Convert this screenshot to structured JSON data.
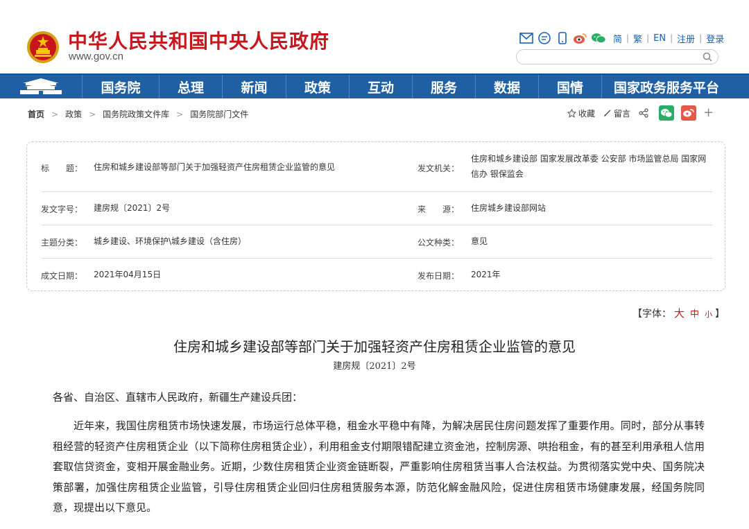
{
  "header": {
    "site_title": "中华人民共和国中央人民政府",
    "site_url": "www.gov.cn",
    "lang_links": [
      "简",
      "繁",
      "EN",
      "注册",
      "登录"
    ],
    "top_icons": [
      "mail-icon",
      "chat-icon",
      "mobile-icon",
      "weibo-icon",
      "wechat-icon"
    ]
  },
  "nav": {
    "items": [
      "国务院",
      "总理",
      "新闻",
      "政策",
      "互动",
      "服务",
      "数据",
      "国情",
      "国家政务服务平台"
    ]
  },
  "breadcrumb": [
    "首页",
    "政策",
    "国务院政策文件库",
    "国务院部门文件"
  ],
  "tools": {
    "favorite": "收藏",
    "comment": "留言"
  },
  "info": {
    "title_label": "标　　题：",
    "title_value": "住房和城乡建设部等部门关于加强轻资产住房租赁企业监管的意见",
    "issuer_label": "发文机关：",
    "issuer_value": "住房和城乡建设部 国家发展改革委 公安部 市场监管总局 国家网信办 银保监会",
    "docno_label": "发文字号：",
    "docno_value": "建房规〔2021〕2号",
    "source_label": "来　　源：",
    "source_value": "住房城乡建设部网站",
    "topic_label": "主题分类：",
    "topic_value": "城乡建设、环境保护\\城乡建设（含住房）",
    "type_label": "公文种类：",
    "type_value": "意见",
    "date_label": "成文日期：",
    "date_value": "2021年04月15日",
    "pub_label": "发布日期：",
    "pub_value": "2021年"
  },
  "fontsize": {
    "prefix": "【字体：",
    "large": "大",
    "medium": "中",
    "small": "小",
    "suffix": "】"
  },
  "article": {
    "title": "住房和城乡建设部等部门关于加强轻资产住房租赁企业监管的意见",
    "docno": "建房规〔2021〕2号",
    "greeting": "各省、自治区、直辖市人民政府，新疆生产建设兵团：",
    "body": "近年来，我国住房租赁市场快速发展，市场运行总体平稳，租金水平稳中有降，为解决居民住房问题发挥了重要作用。同时，部分从事转租经营的轻资产住房租赁企业（以下简称住房租赁企业），利用租金支付期限错配建立资金池，控制房源、哄抬租金，有的甚至利用承租人信用套取信贷资金，变相开展金融业务。近期，少数住房租赁企业资金链断裂，严重影响住房租赁当事人合法权益。为贯彻落实党中央、国务院决策部署，加强住房租赁企业监管，引导住房租赁企业回归住房租赁服务本源，防范化解金融风险，促进住房租赁市场健康发展，经国务院同意，现提出以下意见。"
  },
  "colors": {
    "brand_red": "#c8161d",
    "nav_blue": "#1f5fa3",
    "link_blue": "#1a5fb4",
    "wechat_green": "#2aae67",
    "weibo_red": "#e6594a"
  }
}
